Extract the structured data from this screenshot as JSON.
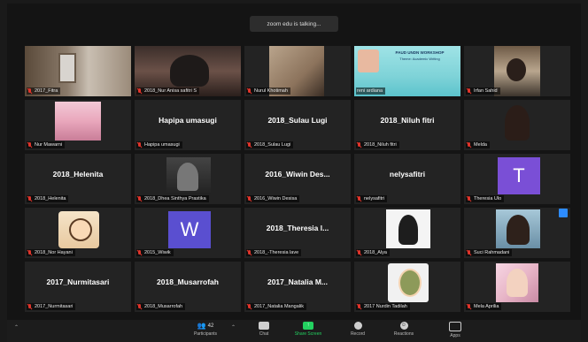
{
  "banner": "zoom edu is talking...",
  "tiles": [
    {
      "big": "",
      "label": "2017_Fitra"
    },
    {
      "big": "",
      "label": "2018_Nur Anisa safitri S"
    },
    {
      "big": "",
      "label": "Nurul Khotimah"
    },
    {
      "big": "",
      "label": "reni ardiana",
      "poster_line1": "PAUD UNDN WORKSHOP",
      "poster_line2": "Theme: Academic Writing"
    },
    {
      "big": "",
      "label": "Irfan Sahid"
    },
    {
      "big": "",
      "label": "Nur Mawarni"
    },
    {
      "big": "Hapipa umasugi",
      "label": "Hapipa umasugi"
    },
    {
      "big": "2018_Sulau Lugi",
      "label": "2018_Sulau Lugi"
    },
    {
      "big": "2018_Niluh fitri",
      "label": "2018_Niluh fitri"
    },
    {
      "big": "",
      "label": "Melda"
    },
    {
      "big": "2018_Helenita",
      "label": "2018_Helenita"
    },
    {
      "big": "",
      "label": "2018_Dhea Sinthya Prastika"
    },
    {
      "big": "2016_Wiwin Des...",
      "label": "2016_Wiwin Desisa"
    },
    {
      "big": "nelysafitri",
      "label": "nelysafitri"
    },
    {
      "big": "",
      "label": "Theresia Ulo",
      "avatar": "T"
    },
    {
      "big": "",
      "label": "2018_Nor Hayani"
    },
    {
      "big": "",
      "label": "2015_Wiwik",
      "avatar": "W"
    },
    {
      "big": "2018_Theresia l...",
      "label": "2018_-Theresia lave"
    },
    {
      "big": "",
      "label": "2018_Alya"
    },
    {
      "big": "",
      "label": "Suci Rahmadani"
    },
    {
      "big": "2017_Nurmitasari",
      "label": "2017_Nurmitasari"
    },
    {
      "big": "2018_Musarrofah",
      "label": "2018_Musarrofah"
    },
    {
      "big": "2017_Natalia M...",
      "label": "2017_Natalia Mangalik"
    },
    {
      "big": "",
      "label": "2017 Nurdin Tadilah"
    },
    {
      "big": "",
      "label": "Mela Aprilia"
    }
  ],
  "toolbar": {
    "participants_count": "42",
    "participants": "Participants",
    "chat": "Chat",
    "share": "Share Screen",
    "record": "Record",
    "reactions": "Reactions",
    "apps": "Apps"
  },
  "colors": {
    "accent": "#2d8cff",
    "share": "#23d160",
    "mute": "#e0342b",
    "avatar": "#7a4fd6"
  }
}
